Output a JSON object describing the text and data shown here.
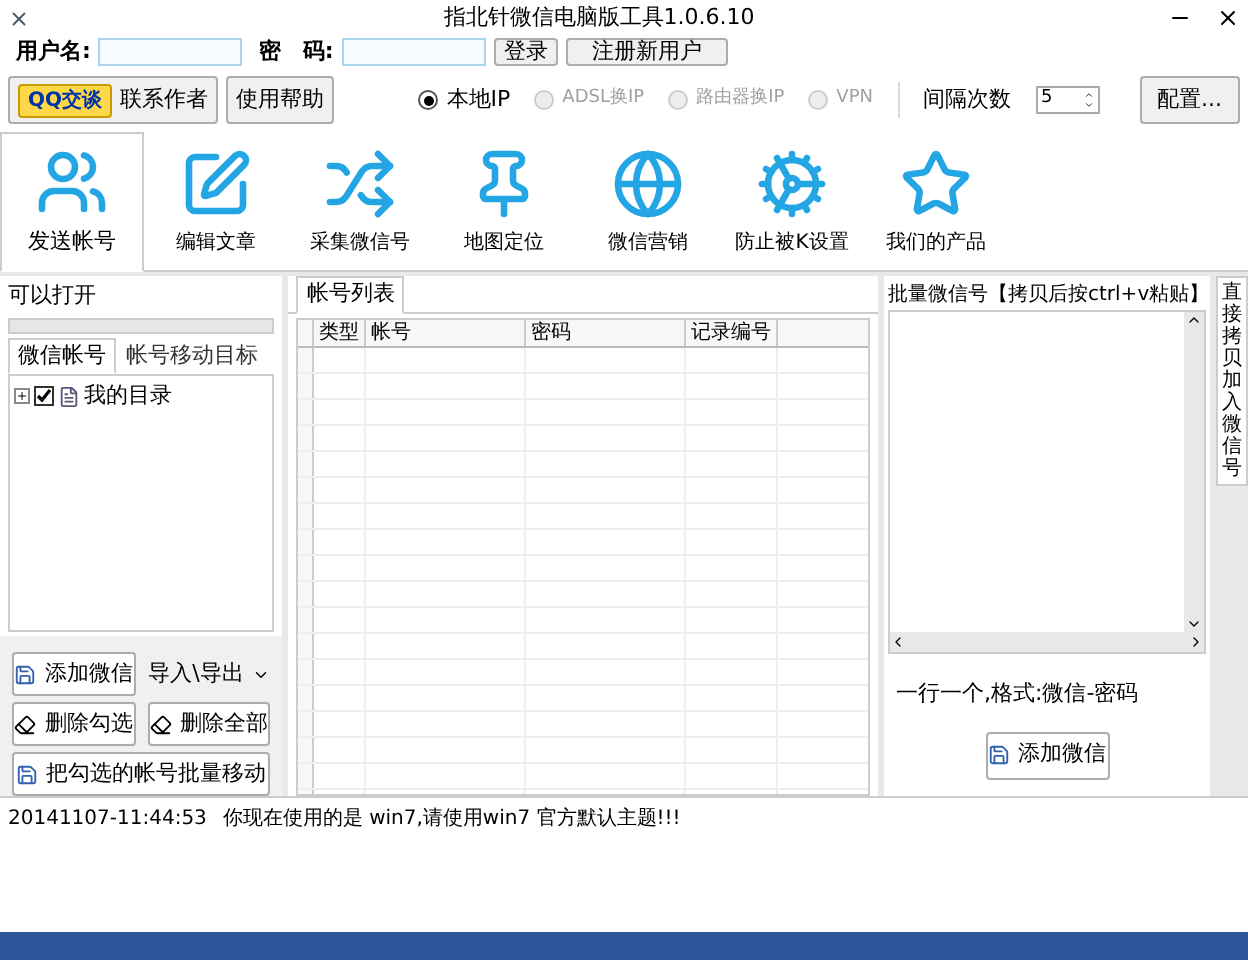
{
  "window": {
    "title": "指北针微信电脑版工具1.0.6.10"
  },
  "login": {
    "username_label": "用户名:",
    "password_label": "密　码:",
    "login_button": "登录",
    "register_button": "注册新用户"
  },
  "toolbar_row": {
    "qq_button": "QQ交谈",
    "contact_label": "联系作者",
    "help_button": "使用帮助",
    "ip_modes": [
      {
        "label": "本地IP",
        "selected": true,
        "disabled": false
      },
      {
        "label": "ADSL换IP",
        "selected": false,
        "disabled": true
      },
      {
        "label": "路由器换IP",
        "selected": false,
        "disabled": true
      },
      {
        "label": "VPN",
        "selected": false,
        "disabled": true
      }
    ],
    "interval_label": "间隔次数",
    "interval_value": "5",
    "config_button": "配置..."
  },
  "tabs": [
    {
      "label": "发送帐号",
      "selected": true
    },
    {
      "label": "编辑文章",
      "selected": false
    },
    {
      "label": "采集微信号",
      "selected": false
    },
    {
      "label": "地图定位",
      "selected": false
    },
    {
      "label": "微信营销",
      "selected": false
    },
    {
      "label": "防止被K设置",
      "selected": false
    },
    {
      "label": "我们的产品",
      "selected": false
    }
  ],
  "left_panel": {
    "status": "可以打开",
    "progress": {
      "level": 0
    },
    "subtabs": [
      {
        "label": "微信帐号",
        "selected": true
      },
      {
        "label": "帐号移动目标",
        "selected": false
      }
    ],
    "tree": [
      {
        "label": "我的目录",
        "checked": true,
        "expanded": false
      }
    ],
    "add_button": "添加微信",
    "import_export": "导入\\导出",
    "delete_checked": "删除勾选",
    "delete_all": "删除全部",
    "move_button": "把勾选的帐号批量移动"
  },
  "table": {
    "tab": "帐号列表",
    "columns": [
      "类型",
      "帐号",
      "密码",
      "记录编号"
    ]
  },
  "right_panel": {
    "title": "批量微信号【拷贝后按ctrl+v粘贴】",
    "hint": "一行一个,格式:微信-密码",
    "add_button": "添加微信",
    "side_tab": "直接拷贝加入微信号"
  },
  "log": [
    {
      "time": "20141107-11:44:53",
      "message": "你现在使用的是 win7,请使用win7 官方默认主题!!!"
    }
  ]
}
